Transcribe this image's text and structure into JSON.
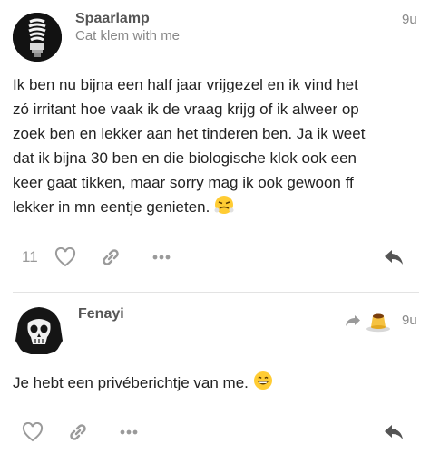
{
  "post1": {
    "username": "Spaarlamp",
    "reply_to": "Cat klem with me",
    "time": "9u",
    "lines": [
      "Ik ben nu bijna een half jaar vrijgezel en ik vind het",
      "zó irritant hoe vaak ik de vraag krijg of ik alweer op",
      "zoek ben en lekker aan het tinderen ben. Ja ik weet",
      "dat ik bijna 30 ben en die biologische klok ook een",
      "keer gaat tikken, maar sorry mag ik ook gewoon ff",
      "lekker in mn eentje genieten."
    ],
    "end_emoji": "steam-from-nose-emoji",
    "like_count": "11",
    "icons": [
      "heart-icon",
      "link-icon",
      "ellipsis-icon",
      "reply-icon"
    ]
  },
  "post2": {
    "username": "Fenayi",
    "time": "9u",
    "reply_emoji": "flan-emoji",
    "text": "Je hebt een privéberichtje van me.",
    "end_emoji": "grinning-emoji",
    "icons": [
      "reply-arrow-icon",
      "heart-icon",
      "link-icon",
      "ellipsis-icon",
      "reply-icon"
    ]
  },
  "colors": {
    "text": "#222222",
    "muted": "#888888",
    "icon": "#9a9a9a",
    "divider": "#e3e3e3",
    "reply_icon": "#555555"
  }
}
